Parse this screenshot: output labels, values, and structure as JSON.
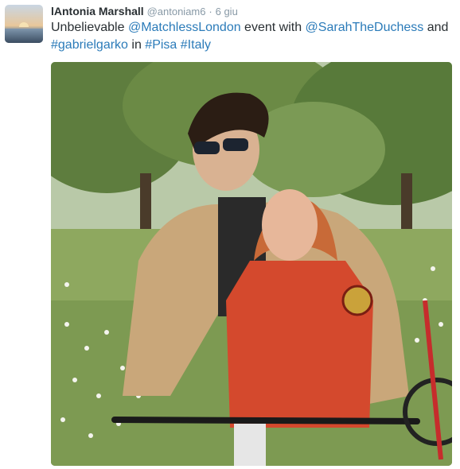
{
  "tweet": {
    "fullname": "lAntonia Marshall",
    "username": "@antoniam6",
    "separator": "·",
    "timestamp": "6 giu",
    "text_parts": {
      "t1": "Unbelievable ",
      "m1": "@MatchlessLondon",
      "t2": " event with ",
      "m2": "@SarahTheDuchess",
      "t3": " and ",
      "h1": "#gabrielgarko",
      "t4": " in ",
      "h2": "#Pisa",
      "t5": " ",
      "h3": "#Italy"
    },
    "colors": {
      "link": "#2b7bb9",
      "name": "#292f33",
      "meta": "#8899a6"
    }
  },
  "media": {
    "type": "photo"
  }
}
